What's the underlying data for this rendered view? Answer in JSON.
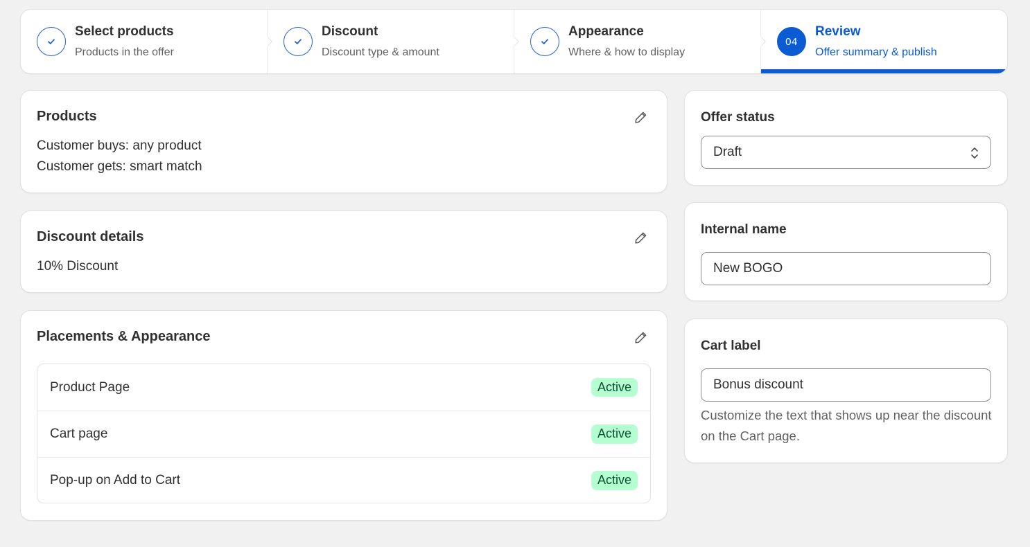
{
  "stepper": {
    "steps": [
      {
        "title": "Select products",
        "subtitle": "Products in the offer",
        "state": "done"
      },
      {
        "title": "Discount",
        "subtitle": "Discount type & amount",
        "state": "done"
      },
      {
        "title": "Appearance",
        "subtitle": "Where & how to display",
        "state": "done"
      },
      {
        "title": "Review",
        "subtitle": "Offer summary & publish",
        "state": "active",
        "number": "04"
      }
    ]
  },
  "products": {
    "title": "Products",
    "buys": "Customer buys: any product",
    "gets": "Customer gets: smart match"
  },
  "discount": {
    "title": "Discount details",
    "value": "10% Discount"
  },
  "placements": {
    "title": "Placements & Appearance",
    "rows": [
      {
        "label": "Product Page",
        "status": "Active"
      },
      {
        "label": "Cart page",
        "status": "Active"
      },
      {
        "label": "Pop-up on Add to Cart",
        "status": "Active"
      }
    ]
  },
  "offer_status": {
    "title": "Offer status",
    "selected": "Draft"
  },
  "internal_name": {
    "title": "Internal name",
    "value": "New BOGO"
  },
  "cart_label": {
    "title": "Cart label",
    "value": "Bonus discount",
    "help": "Customize the text that shows up near the discount on the Cart page."
  },
  "colors": {
    "accent": "#0b5bd3",
    "badge_bg": "#b4fed2",
    "badge_text": "#0c5132",
    "background": "#f1f1f1"
  }
}
